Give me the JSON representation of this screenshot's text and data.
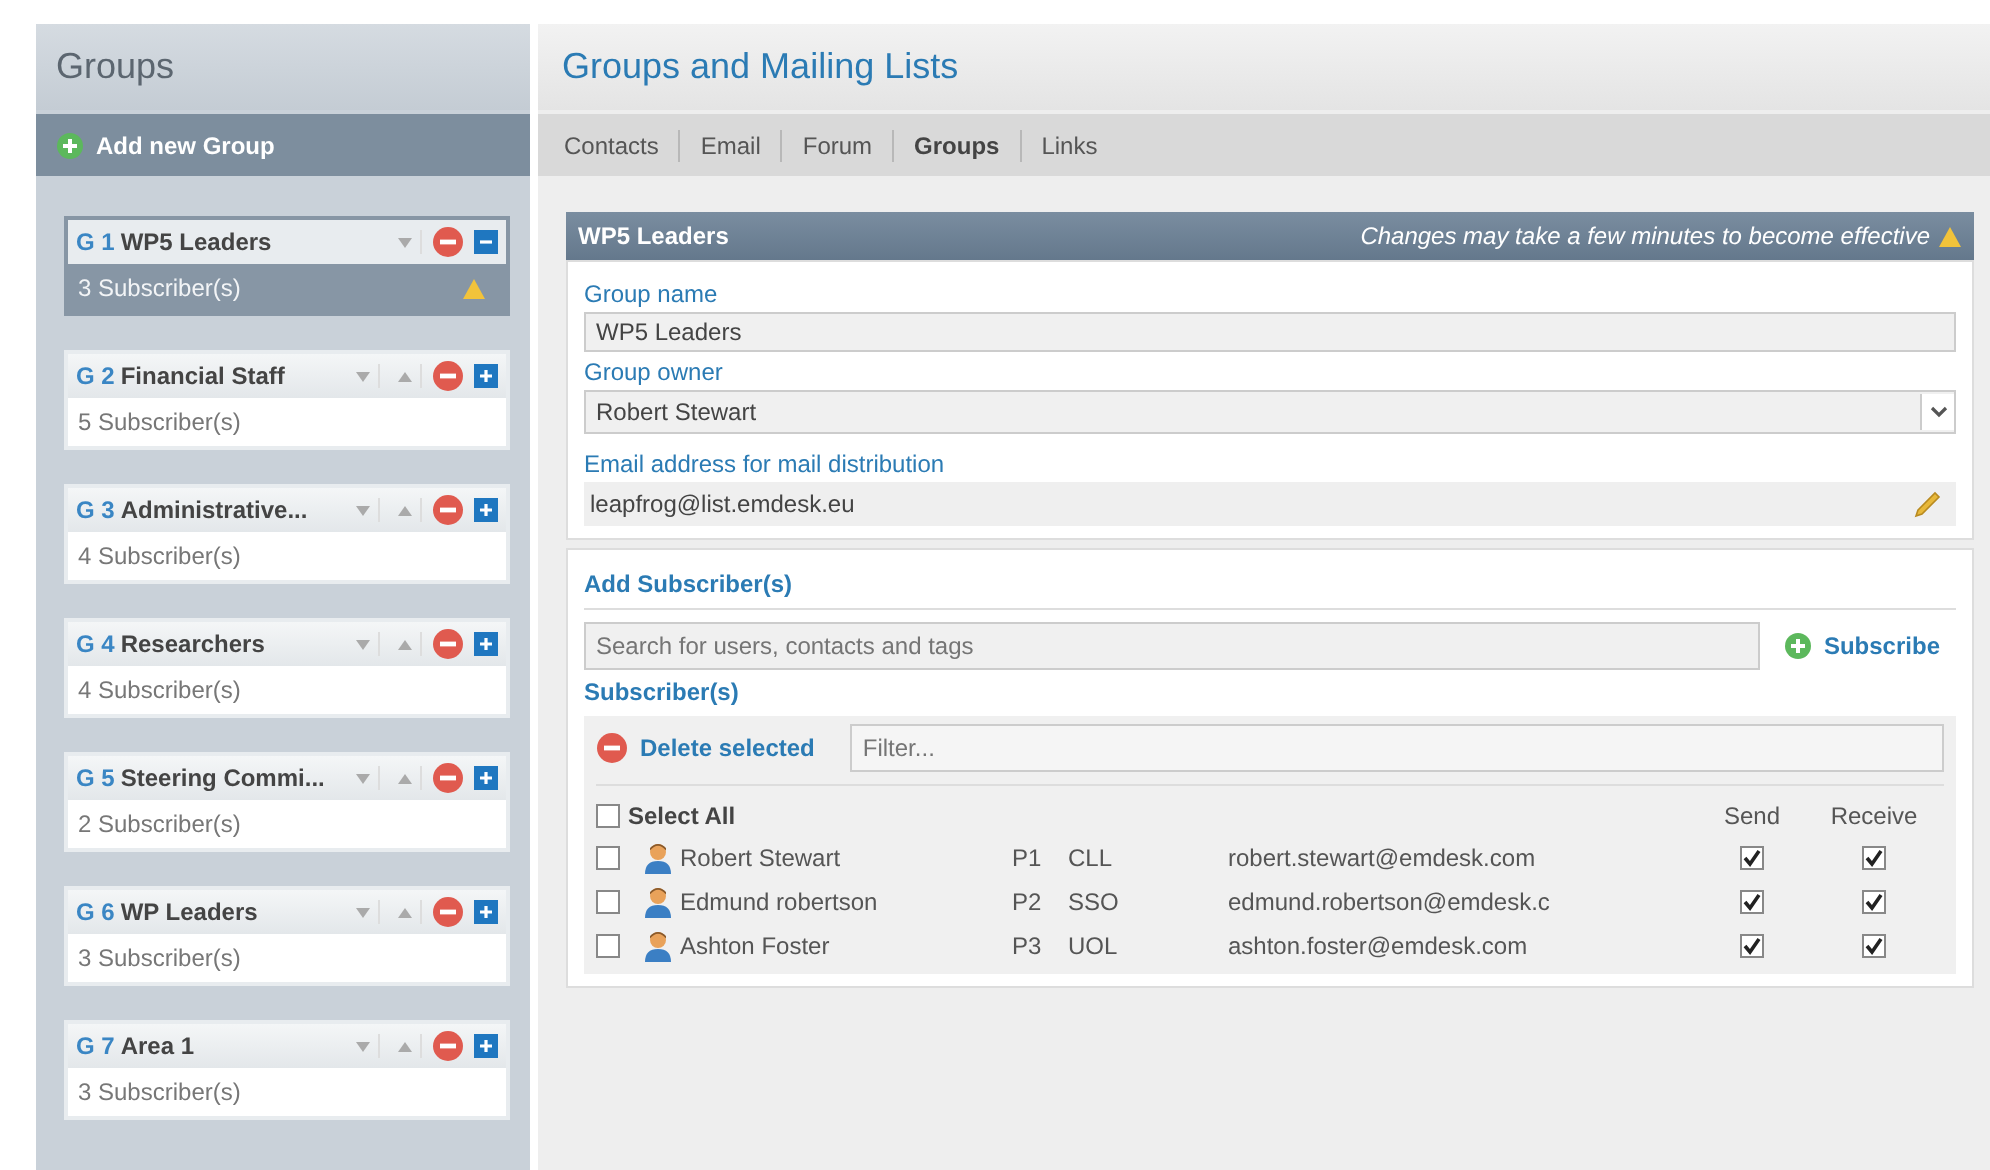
{
  "sidebar": {
    "title": "Groups",
    "add_button": "Add new Group",
    "groups": [
      {
        "code": "G 1",
        "name": "WP5 Leaders",
        "subscribers": "3 Subscriber(s)",
        "selected": true,
        "expanded": true,
        "warning": true
      },
      {
        "code": "G 2",
        "name": "Financial Staff",
        "subscribers": "5 Subscriber(s)",
        "selected": false,
        "expanded": false,
        "warning": false
      },
      {
        "code": "G 3",
        "name": "Administrative...",
        "subscribers": "4 Subscriber(s)",
        "selected": false,
        "expanded": false,
        "warning": false
      },
      {
        "code": "G 4",
        "name": "Researchers",
        "subscribers": "4 Subscriber(s)",
        "selected": false,
        "expanded": false,
        "warning": false
      },
      {
        "code": "G 5",
        "name": "Steering Commi...",
        "subscribers": "2 Subscriber(s)",
        "selected": false,
        "expanded": false,
        "warning": false
      },
      {
        "code": "G 6",
        "name": "WP Leaders",
        "subscribers": "3 Subscriber(s)",
        "selected": false,
        "expanded": false,
        "warning": false
      },
      {
        "code": "G 7",
        "name": "Area 1",
        "subscribers": "3 Subscriber(s)",
        "selected": false,
        "expanded": false,
        "warning": false
      }
    ]
  },
  "main": {
    "title": "Groups and Mailing Lists",
    "tabs": [
      {
        "label": "Contacts",
        "selected": false
      },
      {
        "label": "Email",
        "selected": false
      },
      {
        "label": "Forum",
        "selected": false
      },
      {
        "label": "Groups",
        "selected": true
      },
      {
        "label": "Links",
        "selected": false
      }
    ],
    "panel": {
      "title": "WP5 Leaders",
      "notice": "Changes may take a few minutes to become effective",
      "group_name": {
        "label": "Group name",
        "value": "WP5 Leaders"
      },
      "group_owner": {
        "label": "Group owner",
        "value": "Robert Stewart"
      },
      "email": {
        "label": "Email address for mail distribution",
        "value": "leapfrog@list.emdesk.eu"
      },
      "add_heading": "Add Subscriber(s)",
      "search": {
        "placeholder": "Search for users, contacts and tags"
      },
      "subscribe_button": "Subscribe",
      "subscribers_heading": "Subscriber(s)",
      "delete_button": "Delete selected",
      "filter": {
        "placeholder": "Filter..."
      },
      "select_all": {
        "label": "Select All",
        "checked": false
      },
      "columns": {
        "send": "Send",
        "receive": "Receive"
      },
      "rows": [
        {
          "checked": false,
          "name": "Robert Stewart",
          "partner": "P1",
          "org": "CLL",
          "email": "robert.stewart@emdesk.com",
          "send": true,
          "receive": true
        },
        {
          "checked": false,
          "name": "Edmund robertson",
          "partner": "P2",
          "org": "SSO",
          "email": "edmund.robertson@emdesk.c",
          "send": true,
          "receive": true
        },
        {
          "checked": false,
          "name": "Ashton Foster",
          "partner": "P3",
          "org": "UOL",
          "email": "ashton.foster@emdesk.com",
          "send": true,
          "receive": true
        }
      ]
    }
  }
}
